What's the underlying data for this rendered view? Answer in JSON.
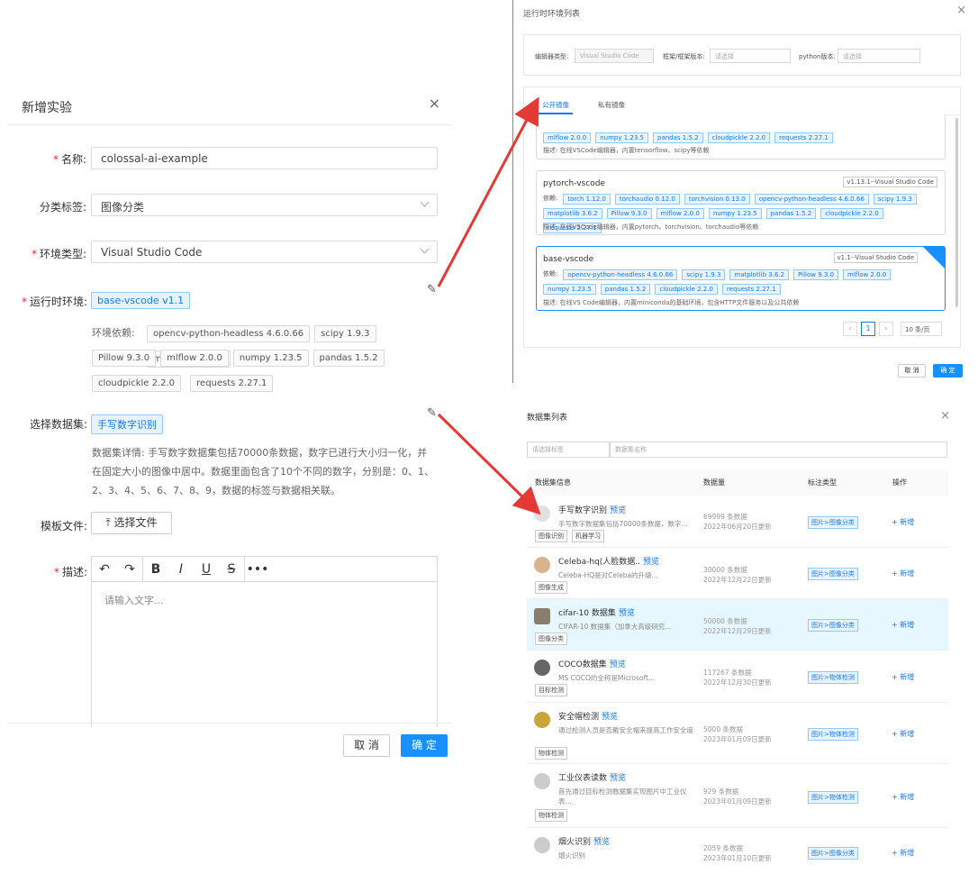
{
  "left_dialog": {
    "title": "新增实验",
    "close": "×",
    "name_label": "名称:",
    "name_value": "colossal-ai-example",
    "category_label": "分类标签:",
    "category_value": "图像分类",
    "env_type_label": "环境类型:",
    "env_type_value": "Visual Studio Code",
    "runtime_label": "运行时环境:",
    "runtime_value": "base-vscode v1.1",
    "deps_label": "环境依赖:",
    "deps": [
      "opencv-python-headless 4.6.0.66",
      "scipy 1.9.3",
      "matplotlib 3.6.2",
      "Pillow 9.3.0",
      "mlflow 2.0.0",
      "numpy 1.23.5",
      "pandas 1.5.2",
      "cloudpickle 2.2.0",
      "requests 2.27.1"
    ],
    "dataset_label": "选择数据集:",
    "dataset_value": "手写数字识别",
    "dataset_detail": "数据集详情:  手写数字数据集包括70000条数据，数字已进行大小归一化，并在固定大小的图像中居中。数据里面包含了10个不同的数字，分别是：0、1、2、3、4、5、6、7、8、9，数据的标签与数据相关联。",
    "template_label": "模板文件:",
    "upload_label": "选择文件",
    "desc_label": "描述:",
    "editor_placeholder": "请输入文字...",
    "cancel": "取 消",
    "ok": "确 定"
  },
  "env_dialog": {
    "title": "运行时环境列表",
    "close": "×",
    "editor_type_label": "编辑器类型:",
    "editor_type_value": "Visual Studio Code",
    "framework_label": "框架/框架版本:",
    "framework_placeholder": "请选择",
    "python_label": "python版本:",
    "python_placeholder": "请选择",
    "tabs": [
      "公开镜像",
      "私有镜像"
    ],
    "cards": [
      {
        "name": "",
        "version": "",
        "deps_label": "",
        "deps": [
          "mlflow 2.0.0",
          "numpy 1.23.5",
          "pandas 1.5.2",
          "cloudpickle 2.2.0",
          "requests 2.27.1"
        ],
        "desc": "描述:   在线VSCode编辑器，内置tensorflow、scipy等依赖"
      },
      {
        "name": "pytorch-vscode",
        "version": "v1.13.1--Visual Studio Code",
        "deps_label": "依赖:",
        "deps": [
          "torch 1.12.0",
          "torchaudio 0.12.0",
          "torchvision 0.13.0",
          "opencv-python-headless 4.6.0.66",
          "scipy 1.9.3",
          "matplotlib 3.6.2",
          "Pillow 9.3.0",
          "mlflow 2.0.0",
          "numpy 1.23.5",
          "pandas 1.5.2",
          "cloudpickle 2.2.0",
          "requests 2.27.1"
        ],
        "desc": "描述:   在线VSCode编辑器，内置pytorch、torchvision、torchaudio等依赖"
      },
      {
        "name": "base-vscode",
        "version": "v1.1--Visual Studio Code",
        "deps_label": "依赖:",
        "deps": [
          "opencv-python-headless 4.6.0.66",
          "scipy 1.9.3",
          "matplotlib 3.6.2",
          "Pillow 9.3.0",
          "mlflow 2.0.0",
          "numpy 1.23.5",
          "pandas 1.5.2",
          "cloudpickle 2.2.0",
          "requests 2.27.1"
        ],
        "desc": "描述:   在线VS Code编辑器，内置miniconda的基础环境，包含HTTP文件服务以及公共依赖"
      }
    ],
    "page": "1",
    "page_size": "10 条/页",
    "cancel": "取 消",
    "ok": "确 定"
  },
  "dataset_dialog": {
    "title": "数据集列表",
    "close": "×",
    "tag_placeholder": "请选择标签",
    "name_placeholder": "数据集名称",
    "headers": [
      "数据集信息",
      "数据量",
      "标注类型",
      "操作"
    ],
    "preview": "预览",
    "add": "+ 新增",
    "rows": [
      {
        "name": "手写数字识别",
        "desc": "手写数字数据集包括70000条数据，数字...",
        "tags": [
          "图像识别",
          "机器学习"
        ],
        "count": "69999 条数据",
        "updated": "2022年06月20日更新",
        "annotation": "图片>图像分类"
      },
      {
        "name": "Celeba-hq(人脸数据..",
        "desc": "Celeba-HQ是对Celeba的升级...",
        "tags": [
          "图像生成"
        ],
        "count": "30000 条数据",
        "updated": "2022年12月22日更新",
        "annotation": "图片>图像分类"
      },
      {
        "name": "cifar-10 数据集",
        "desc": "CIFAR-10 数据集（加拿大高级研究...",
        "tags": [
          "图像分类"
        ],
        "count": "50000 条数据",
        "updated": "2022年12月29日更新",
        "annotation": "图片>图像分类"
      },
      {
        "name": "COCO数据集",
        "desc": "MS COCO的全称是Microsoft...",
        "tags": [
          "目标检测"
        ],
        "count": "117267 条数据",
        "updated": "2022年12月30日更新",
        "annotation": "图片>物体检测"
      },
      {
        "name": "安全帽检测",
        "desc": "通过检测人员是否戴安全帽来提高工作安全度",
        "tags": [
          "物体检测"
        ],
        "count": "5000 条数据",
        "updated": "2023年01月09日更新",
        "annotation": "图片>物体检测"
      },
      {
        "name": "工业仪表读数",
        "desc": "首先通过目标检测数据集实现图片中工业仪表...",
        "tags": [
          "物体检测"
        ],
        "count": "929 条数据",
        "updated": "2023年01月09日更新",
        "annotation": "图片>物体检测"
      },
      {
        "name": "烟火识别",
        "desc": "烟火识别",
        "tags": [],
        "count": "2059 条数据",
        "updated": "2023年01月10日更新",
        "annotation": "图片>图像分类"
      }
    ]
  },
  "colors": {
    "accent": "#1890ff",
    "arrow": "#e53935",
    "required": "#f5222d"
  }
}
